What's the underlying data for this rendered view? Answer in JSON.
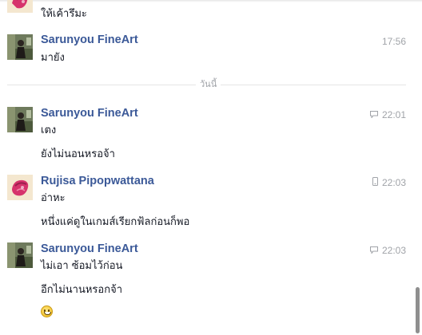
{
  "conversation": {
    "top_partial_message": "ให้เค้ารึมะ",
    "date_divider": "วันนี้",
    "blocks": [
      {
        "sender": "Sarunyou FineArt",
        "time": "17:56",
        "device_icon": "none",
        "messages": [
          "มายัง"
        ]
      },
      {
        "sender": "Sarunyou FineArt",
        "time": "22:01",
        "device_icon": "chat-bubble-icon",
        "messages": [
          "เตง",
          "ยังไม่นอนหรอจ้า"
        ]
      },
      {
        "sender": "Rujisa Pipopwattana",
        "time": "22:03",
        "device_icon": "mobile-phone-icon",
        "messages": [
          "อ่าหะ",
          "หนึ่งแค่ดูในเกมส์เรียกฟ้ลก่อนก็พอ"
        ]
      },
      {
        "sender": "Sarunyou FineArt",
        "time": "22:03",
        "device_icon": "chat-bubble-icon",
        "messages": [
          "ไม่เอา ซ้อมไว้ก่อน",
          "อีกไม่นานหรอกจ้า"
        ],
        "emoji": "smiley-emoji-icon"
      }
    ]
  },
  "colors": {
    "sender_name": "#3b5998",
    "message_text": "#141823",
    "timestamp": "#a0a3a8",
    "divider": "#e5e5e5"
  }
}
